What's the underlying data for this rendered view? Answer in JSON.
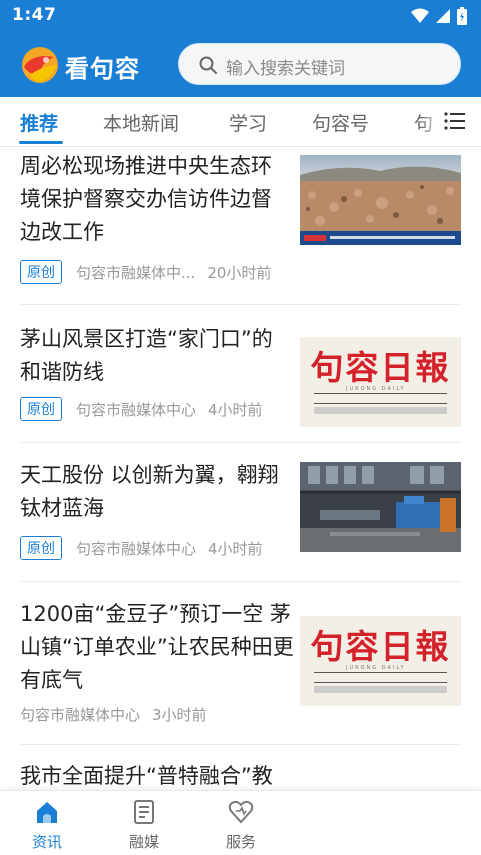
{
  "status_bar": {
    "time": "1:47"
  },
  "app": {
    "name": "看句容"
  },
  "search": {
    "placeholder": "输入搜索关键词"
  },
  "tabs": [
    {
      "label": "推荐",
      "active": true
    },
    {
      "label": "本地新闻",
      "active": false
    },
    {
      "label": "学习",
      "active": false
    },
    {
      "label": "句容号",
      "active": false
    },
    {
      "label": "句",
      "active": false
    }
  ],
  "news": [
    {
      "title": "周必松现场推进中央生态环境保护督察交办信访件边督边改工作",
      "badge": "原创",
      "source": "句容市融媒体中...",
      "time": "20小时前",
      "thumb": "photo-field"
    },
    {
      "title": "茅山风景区打造“家门口”的和谐防线",
      "badge": "原创",
      "source": "句容市融媒体中心",
      "time": "4小时前",
      "thumb": "newspaper"
    },
    {
      "title": "天工股份 以创新为翼，翱翔钛材蓝海",
      "badge": "原创",
      "source": "句容市融媒体中心",
      "time": "4小时前",
      "thumb": "photo-factory"
    },
    {
      "title": "1200亩“金豆子”预订一空 茅山镇“订单农业”让农民种田更有底气",
      "badge": "",
      "source": "句容市融媒体中心",
      "time": "3小时前",
      "thumb": "newspaper"
    },
    {
      "title": "我市全面提升“普特融合”教",
      "badge": "",
      "source": "",
      "time": "",
      "thumb": ""
    }
  ],
  "newspaper": {
    "name": "句容日報",
    "subtitle": "JURONG DAILY"
  },
  "bottom_nav": [
    {
      "label": "资讯",
      "icon": "home-icon",
      "active": true
    },
    {
      "label": "融媒",
      "icon": "document-icon",
      "active": false
    },
    {
      "label": "服务",
      "icon": "heart-icon",
      "active": false
    }
  ],
  "colors": {
    "primary": "#1a7fd4",
    "text": "#222222",
    "muted": "#999999"
  }
}
